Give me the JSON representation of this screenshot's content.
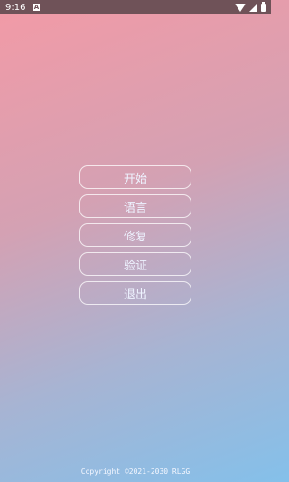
{
  "statusbar": {
    "time": "9:16",
    "notification_glyph": "A",
    "icons": [
      "wifi-icon",
      "signal-icon",
      "battery-icon"
    ]
  },
  "menu": {
    "items": [
      {
        "label": "开始"
      },
      {
        "label": "语言"
      },
      {
        "label": "修复"
      },
      {
        "label": "验证"
      },
      {
        "label": "退出"
      }
    ]
  },
  "footer": {
    "copyright": "Copyright ©2021-2030 RLGG"
  },
  "colors": {
    "gradient_start": "#f39aa6",
    "gradient_end": "#84c0ea",
    "statusbar": "#6f5258",
    "button_border": "#ffffff"
  }
}
